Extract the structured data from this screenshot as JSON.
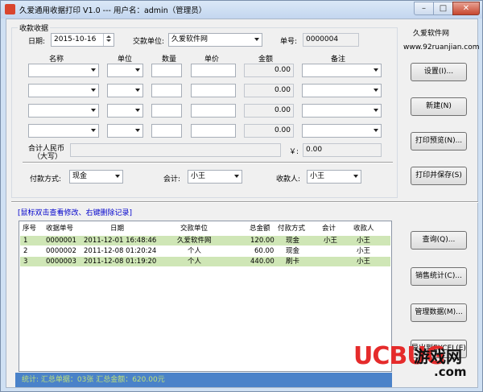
{
  "window": {
    "title": "久爱通用收据打印 V1.0 --- 用户名：admin（管理员）",
    "min": "–",
    "max": "□",
    "close": "✕"
  },
  "receipt": {
    "group_title": "收款收据",
    "date_label": "日期:",
    "date_value": "2015-10-16",
    "payer_label": "交款单位:",
    "payer_value": "久爱软件网",
    "no_label": "单号:",
    "no_value": "0000004",
    "columns": [
      "名称",
      "单位",
      "数量",
      "单价",
      "金额",
      "备注"
    ],
    "line_amounts": [
      "0.00",
      "0.00",
      "0.00",
      "0.00"
    ],
    "total_label_1": "合计人民币",
    "total_label_2": "（大写）",
    "yen_label": "￥:",
    "total_value": "0.00",
    "pay_method_label": "付款方式:",
    "pay_method_value": "现金",
    "accountant_label": "会计:",
    "accountant_value": "小王",
    "cashier_label": "收款人:",
    "cashier_value": "小王"
  },
  "brand": {
    "name": "久爱软件网",
    "url": "www.92ruanjian.com"
  },
  "buttons": {
    "settings": "设置(I)...",
    "new": "新建(N)",
    "preview": "打印预览(N)...",
    "print_save": "打印并保存(S)",
    "query": "查询(Q)...",
    "sales_stats": "销售统计(C)...",
    "manage_data": "管理数据(M)...",
    "export_excel": "导出到EXCEL(E)"
  },
  "list": {
    "hint": "[鼠标双击查看修改、右键删除记录]",
    "columns": [
      "序号",
      "收据单号",
      "日期",
      "交款单位",
      "总金额",
      "付款方式",
      "会计",
      "收款人"
    ],
    "rows": [
      [
        "1",
        "0000001",
        "2011-12-01 16:48:46",
        "久爱软件网",
        "120.00",
        "现金",
        "小王",
        "小王"
      ],
      [
        "2",
        "0000002",
        "2011-12-08 01:20:24",
        "个人",
        "60.00",
        "现金",
        "",
        "小王"
      ],
      [
        "3",
        "0000003",
        "2011-12-08 01:19:20",
        "个人",
        "440.00",
        "刷卡",
        "",
        "小王"
      ]
    ]
  },
  "status": {
    "text": "统计:   汇总单据：03张      汇总金额：620.00元"
  },
  "watermark": {
    "text1": "UCBUG",
    "text2": "游戏网",
    "text3": ".com"
  }
}
